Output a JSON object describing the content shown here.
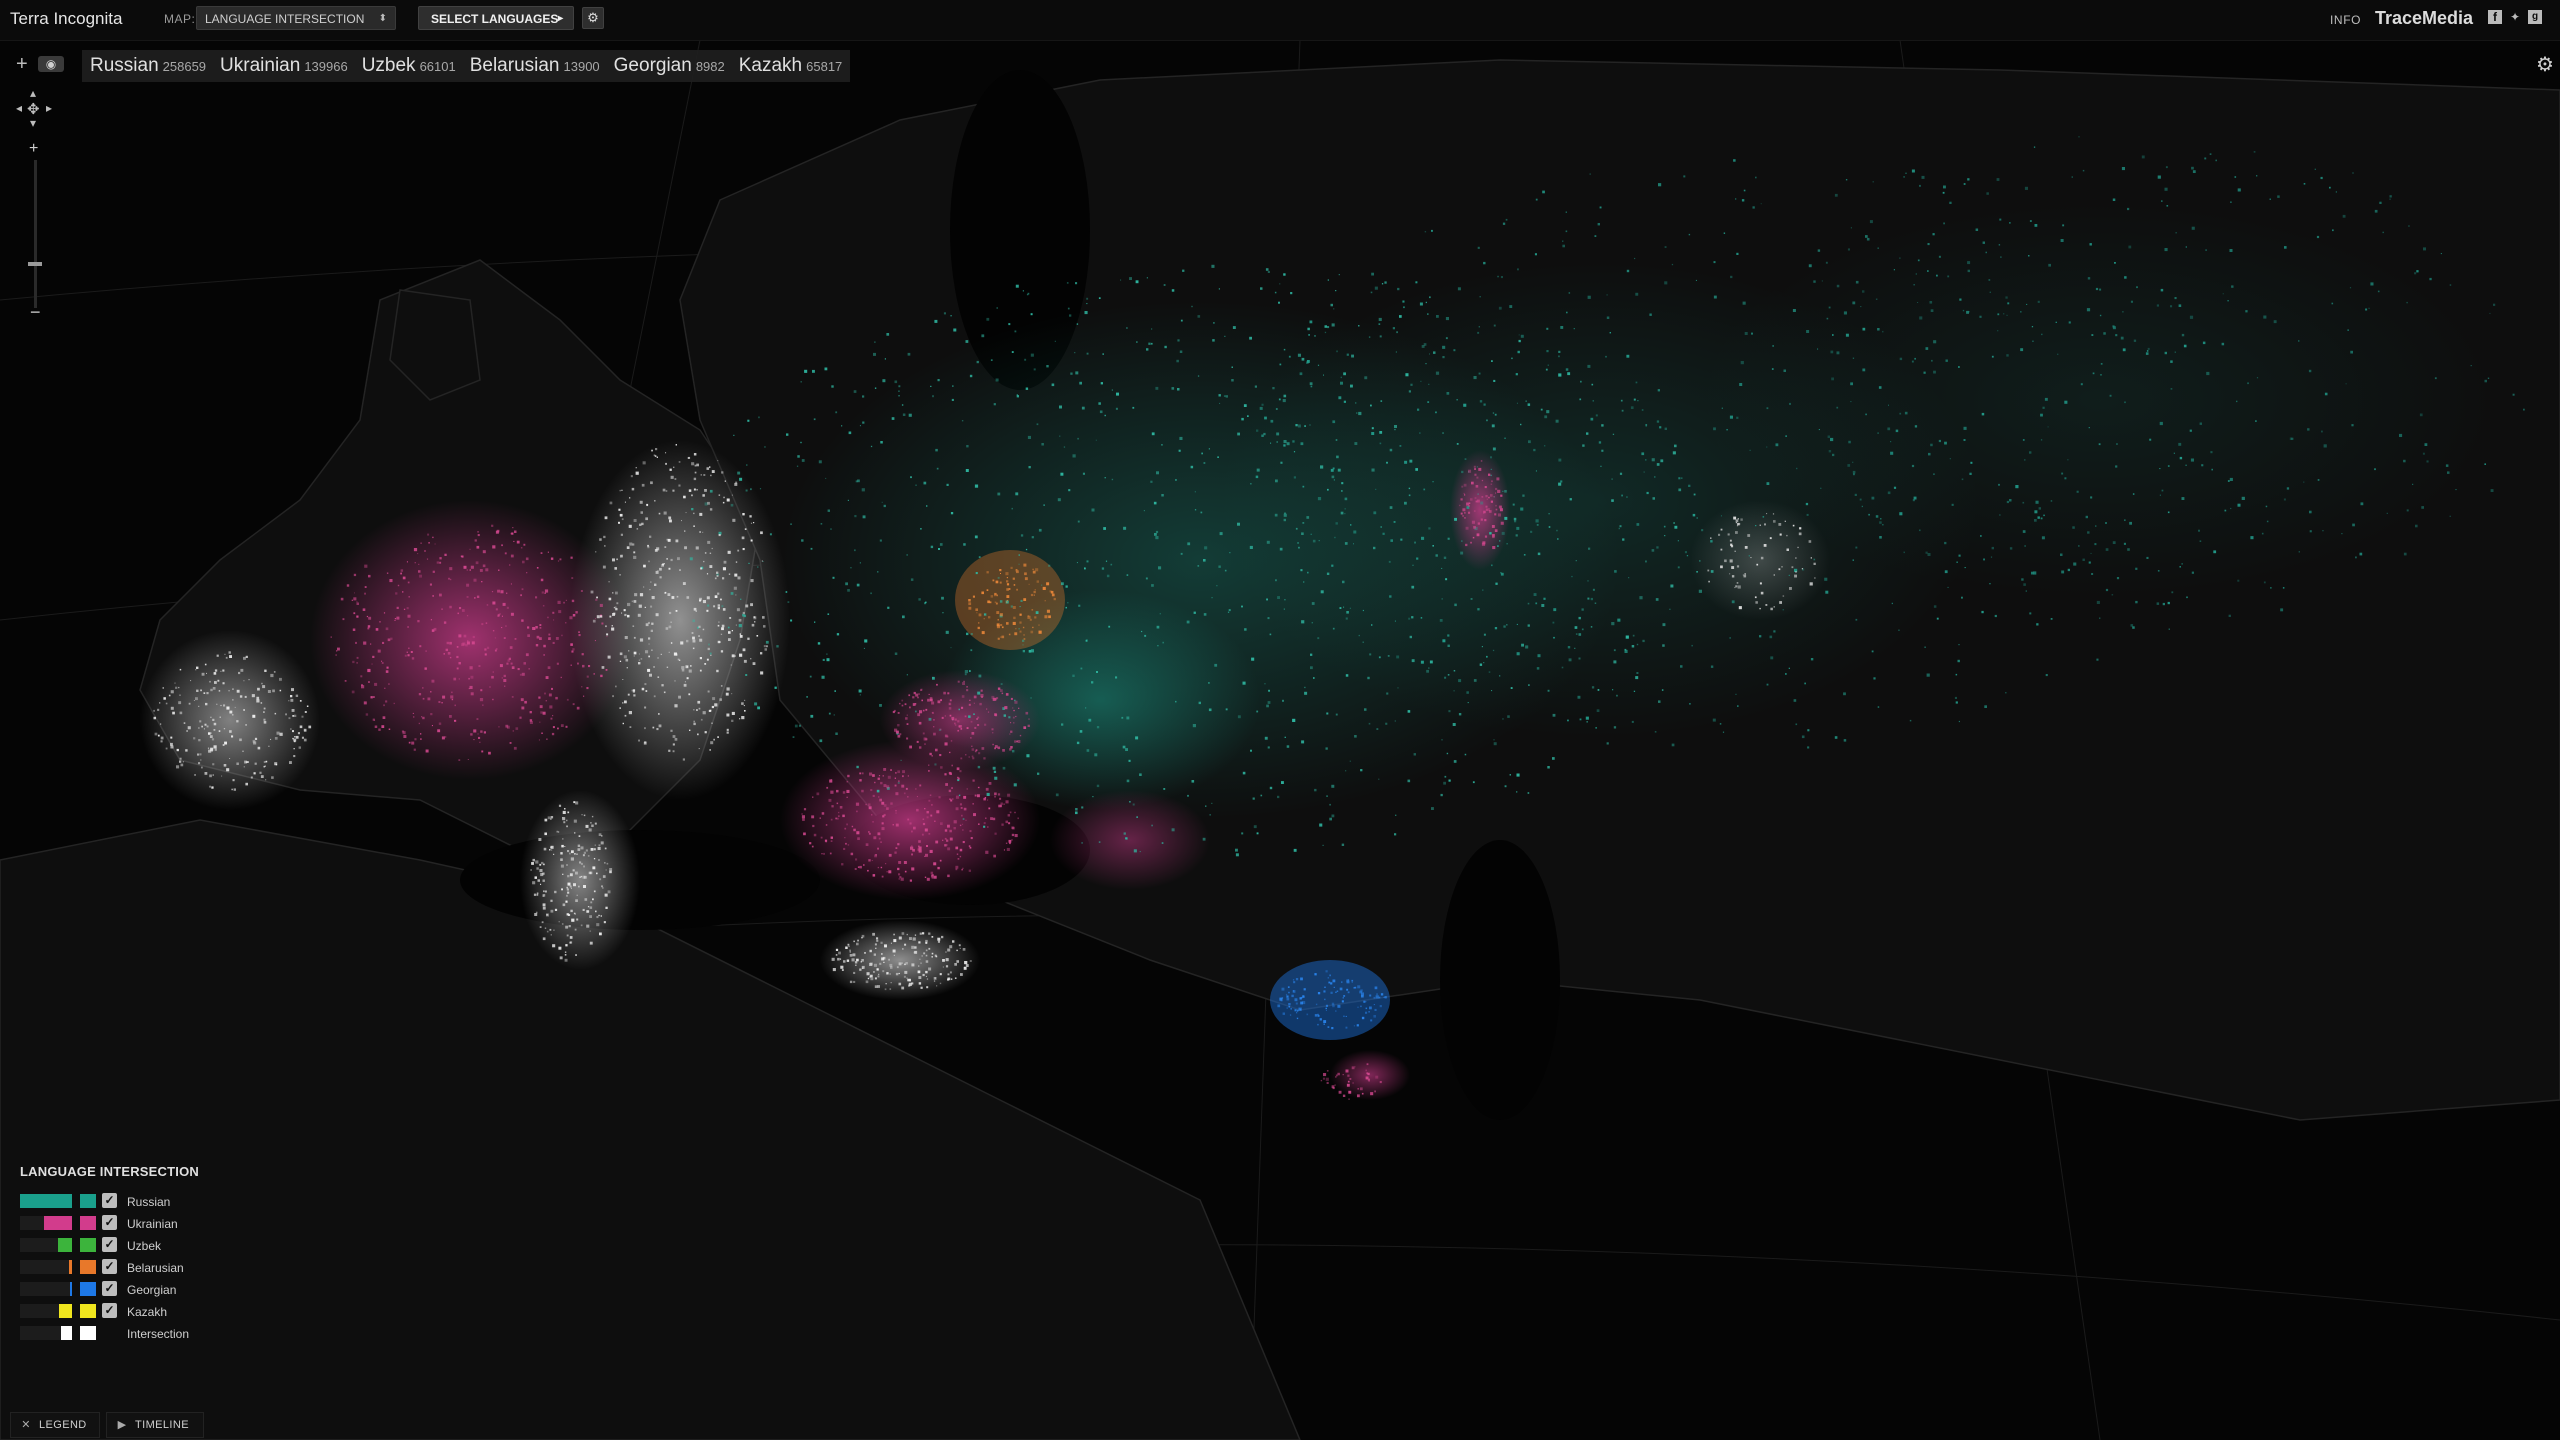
{
  "app": {
    "title": "Terra Incognita",
    "map_label": "MAP:",
    "map_selected": "LANGUAGE INTERSECTION",
    "select_languages": "SELECT LANGUAGES",
    "info": "INFO",
    "brand": "TraceMedia"
  },
  "icons": {
    "settings": "gear-icon",
    "add": "plus-icon",
    "visibility": "eye-icon",
    "pan": "pan-arrows-icon",
    "social": [
      "facebook-icon",
      "twitter-icon",
      "google-plus-icon"
    ]
  },
  "languages": [
    {
      "name": "Russian",
      "count": "258659",
      "color": "#1aa08c",
      "share": 1.0
    },
    {
      "name": "Ukrainian",
      "count": "139966",
      "color": "#d23c8c",
      "share": 0.54
    },
    {
      "name": "Uzbek",
      "count": "66101",
      "color": "#3cb43c",
      "share": 0.26
    },
    {
      "name": "Belarusian",
      "count": "13900",
      "color": "#e8782a",
      "share": 0.05
    },
    {
      "name": "Georgian",
      "count": "8982",
      "color": "#1e78e6",
      "share": 0.03
    },
    {
      "name": "Kazakh",
      "count": "65817",
      "color": "#f0e61e",
      "share": 0.25
    }
  ],
  "legend": {
    "title": "LANGUAGE INTERSECTION",
    "intersection_label": "Intersection",
    "intersection_color": "#ffffff",
    "intersection_share": 0.22,
    "check": "✓"
  },
  "bottom": {
    "legend_label": "LEGEND",
    "timeline_label": "TIMELINE"
  },
  "zoom": {
    "in": "+",
    "out": "−",
    "level": 0.7
  }
}
